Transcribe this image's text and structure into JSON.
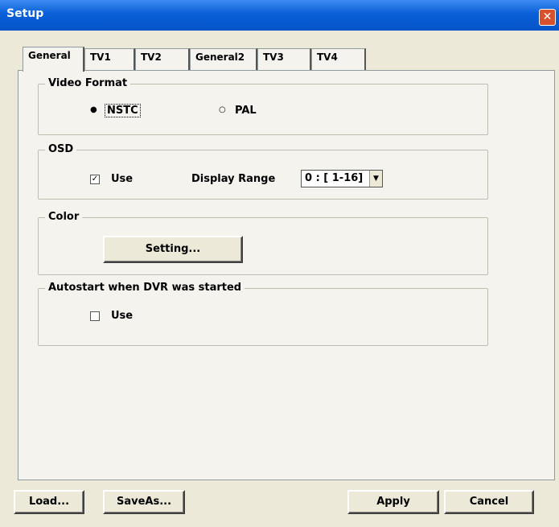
{
  "window": {
    "title": "Setup",
    "close_glyph": "✕"
  },
  "tabs": [
    {
      "label": "General",
      "active": true
    },
    {
      "label": "TV1",
      "active": false
    },
    {
      "label": "TV2",
      "active": false
    },
    {
      "label": "General2",
      "active": false
    },
    {
      "label": "TV3",
      "active": false
    },
    {
      "label": "TV4",
      "active": false
    }
  ],
  "video_format": {
    "label": "Video Format",
    "options": [
      {
        "label": "NSTC",
        "selected": true
      },
      {
        "label": "PAL",
        "selected": false
      }
    ]
  },
  "osd": {
    "label": "OSD",
    "use_label": "Use",
    "use_checked": true,
    "display_range_label": "Display Range",
    "display_range_value": "0 : [ 1-16]"
  },
  "color": {
    "label": "Color",
    "setting_button": "Setting..."
  },
  "autostart": {
    "label": "Autostart when DVR was started",
    "use_label": "Use",
    "use_checked": false
  },
  "footer": {
    "load_button": "Load...",
    "saveas_button": "SaveAs...",
    "apply_button": "Apply",
    "cancel_button": "Cancel"
  },
  "glyphs": {
    "radio_selected": "●",
    "radio_unselected": "○",
    "check_mark": "✓",
    "dropdown_arrow": "▼"
  }
}
